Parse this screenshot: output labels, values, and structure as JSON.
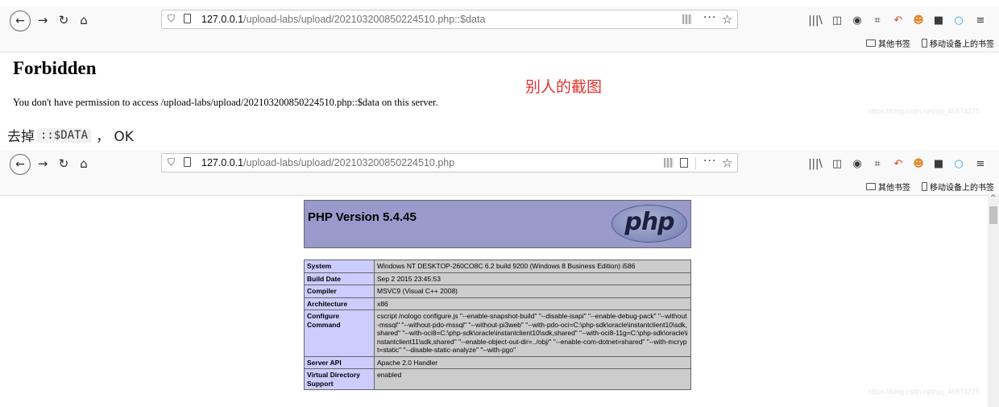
{
  "browser1": {
    "url_host": "127.0.0.1",
    "url_path": "/upload-labs/upload/202103200850224510.php::$data",
    "bookmarks": [
      "其他书签",
      "移动设备上的书签"
    ]
  },
  "forbidden_page": {
    "title": "Forbidden",
    "message": "You don't have permission to access /upload-labs/upload/202103200850224510.php::$data on this server."
  },
  "annotation": "别人的截图",
  "watermark": "https://blog.csdn.net/qq_45874275",
  "caption": {
    "prefix": "去掉",
    "code": "::$DATA",
    "suffix": "， OK"
  },
  "browser2": {
    "url_host": "127.0.0.1",
    "url_path": "/upload-labs/upload/202103200850224510.php",
    "bookmarks": [
      "其他书签",
      "移动设备上的书签"
    ]
  },
  "phpinfo": {
    "version_title": "PHP Version 5.4.45",
    "logo_text": "php",
    "rows": [
      {
        "key": "System",
        "value": "Windows NT DESKTOP-260CO8C 6.2 build 9200 (Windows 8 Business Edition) i586"
      },
      {
        "key": "Build Date",
        "value": "Sep 2 2015 23:45:53"
      },
      {
        "key": "Compiler",
        "value": "MSVC9 (Visual C++ 2008)"
      },
      {
        "key": "Architecture",
        "value": "x86"
      },
      {
        "key": "Configure Command",
        "value": "cscript /nologo configure.js \"--enable-snapshot-build\" \"--disable-isapi\" \"--enable-debug-pack\" \"--without-mssql\" \"--without-pdo-mssql\" \"--without-pi3web\" \"--with-pdo-oci=C:\\php-sdk\\oracle\\instantclient10\\sdk,shared\" \"--with-oci8=C:\\php-sdk\\oracle\\instantclient10\\sdk,shared\" \"--with-oci8-11g=C:\\php-sdk\\oracle\\instantclient11\\sdk,shared\" \"--enable-object-out-dir=../obj/\" \"--enable-com-dotnet=shared\" \"--with-mcrypt=static\" \"--disable-static-analyze\" \"--with-pgo\""
      },
      {
        "key": "Server API",
        "value": "Apache 2.0 Handler"
      },
      {
        "key": "Virtual Directory Support",
        "value": "enabled"
      }
    ]
  }
}
